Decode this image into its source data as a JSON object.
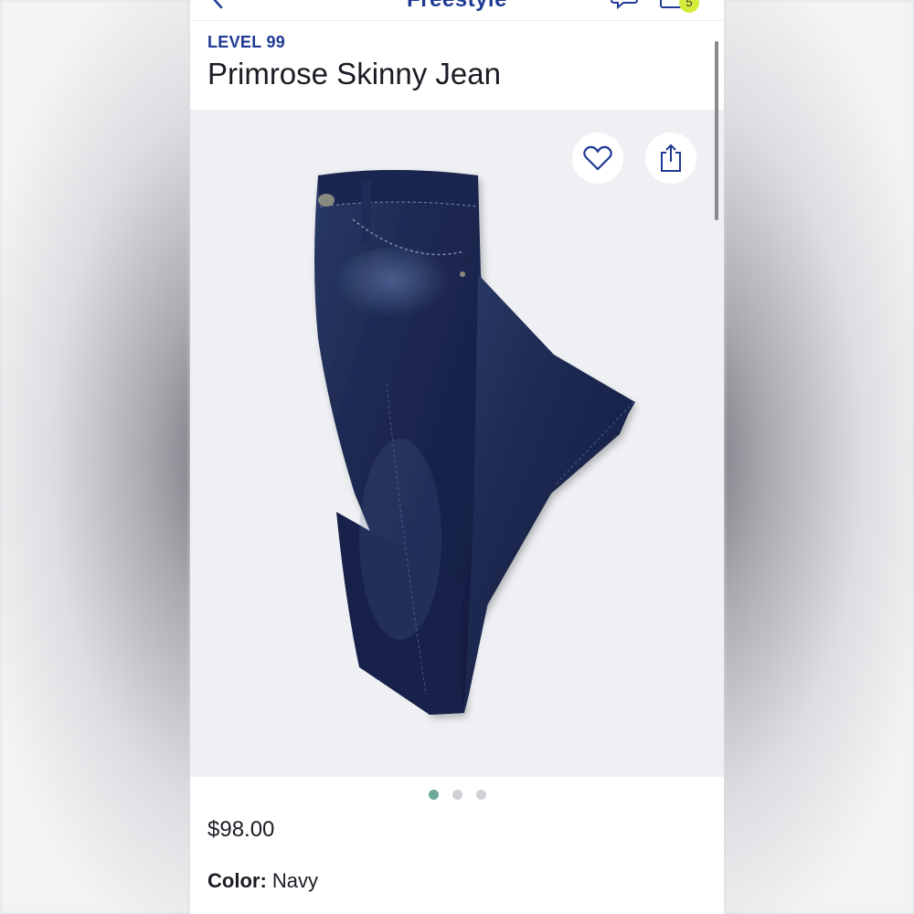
{
  "topbar": {
    "title": "Freestyle",
    "bag_count": "5"
  },
  "product": {
    "brand": "LEVEL 99",
    "name": "Primrose Skinny Jean",
    "price": "$98.00",
    "color_label": "Color:",
    "color_value": "Navy",
    "image_count": 3,
    "active_image": 1
  },
  "icons": {
    "back": "chevron-left-icon",
    "chat": "chat-bubbles-icon",
    "bag": "bag-icon",
    "favorite": "heart-icon",
    "share": "share-icon"
  },
  "colors": {
    "brand_blue": "#1f3a93",
    "badge": "#d6ec3a",
    "dot_active": "#6aa89a",
    "image_bg": "#eef0f3"
  }
}
